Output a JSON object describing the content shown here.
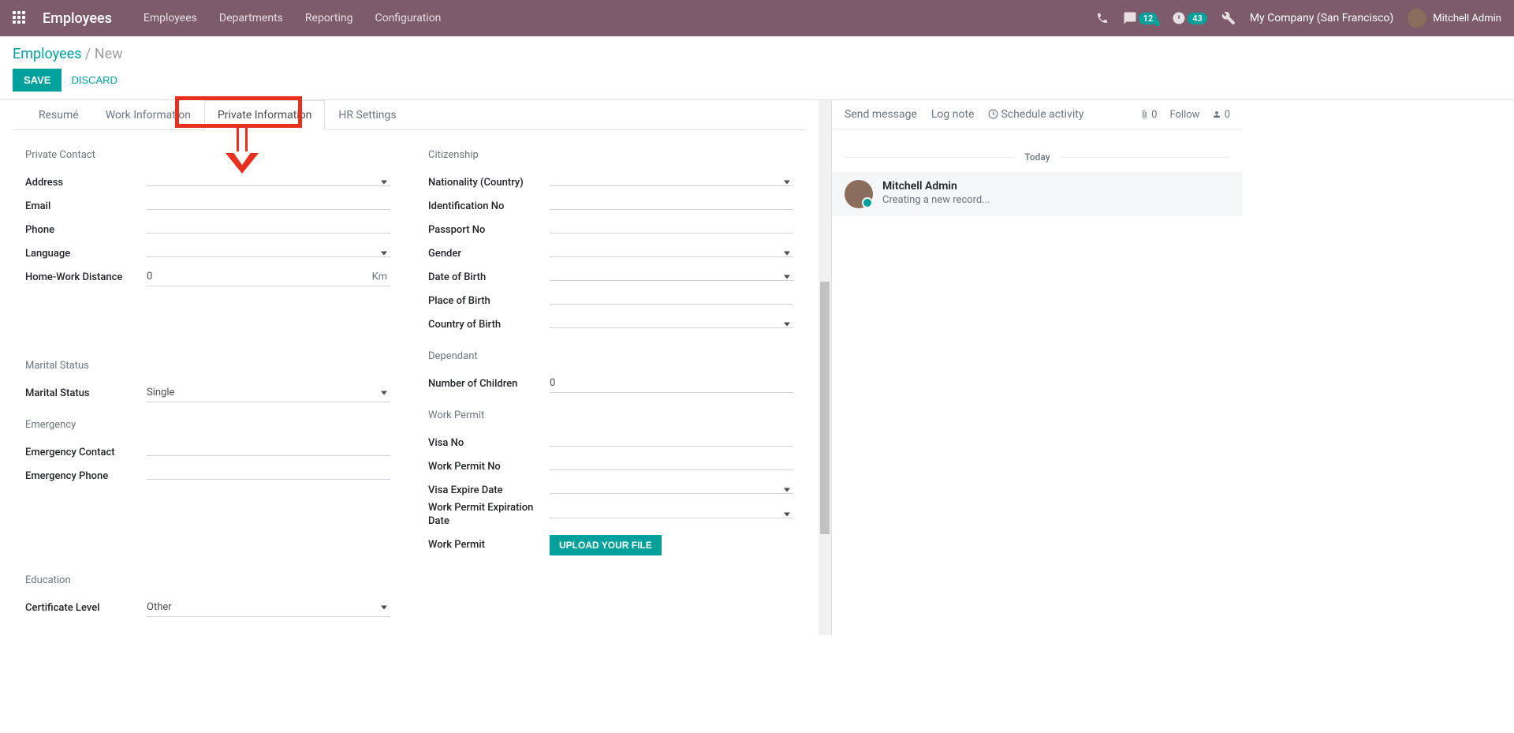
{
  "navbar": {
    "brand": "Employees",
    "menu": [
      "Employees",
      "Departments",
      "Reporting",
      "Configuration"
    ],
    "messages_count": "12",
    "activities_count": "43",
    "company": "My Company (San Francisco)",
    "user": "Mitchell Admin"
  },
  "breadcrumb": {
    "root": "Employees",
    "current": "New"
  },
  "actions": {
    "save": "SAVE",
    "discard": "DISCARD"
  },
  "tabs": [
    "Resumé",
    "Work Information",
    "Private Information",
    "HR Settings"
  ],
  "form": {
    "private_contact": {
      "title": "Private Contact",
      "address": "Address",
      "email": "Email",
      "phone": "Phone",
      "language": "Language",
      "home_work_distance": "Home-Work Distance",
      "home_work_distance_value": "0",
      "distance_unit": "Km"
    },
    "marital": {
      "title": "Marital Status",
      "status_label": "Marital Status",
      "status_value": "Single"
    },
    "emergency": {
      "title": "Emergency",
      "contact": "Emergency Contact",
      "phone": "Emergency Phone"
    },
    "education": {
      "title": "Education",
      "certificate_label": "Certificate Level",
      "certificate_value": "Other"
    },
    "citizenship": {
      "title": "Citizenship",
      "nationality": "Nationality (Country)",
      "id_no": "Identification No",
      "passport": "Passport No",
      "gender": "Gender",
      "dob": "Date of Birth",
      "pob": "Place of Birth",
      "cob": "Country of Birth"
    },
    "dependant": {
      "title": "Dependant",
      "children_label": "Number of Children",
      "children_value": "0"
    },
    "work_permit": {
      "title": "Work Permit",
      "visa_no": "Visa No",
      "permit_no": "Work Permit No",
      "visa_expire": "Visa Expire Date",
      "permit_expire": "Work Permit Expiration Date",
      "permit_label": "Work Permit",
      "upload": "UPLOAD YOUR FILE"
    }
  },
  "chatter": {
    "send": "Send message",
    "log": "Log note",
    "schedule": "Schedule activity",
    "attach_count": "0",
    "follow": "Follow",
    "follower_count": "0",
    "separator": "Today",
    "msg_author": "Mitchell Admin",
    "msg_text": "Creating a new record..."
  }
}
